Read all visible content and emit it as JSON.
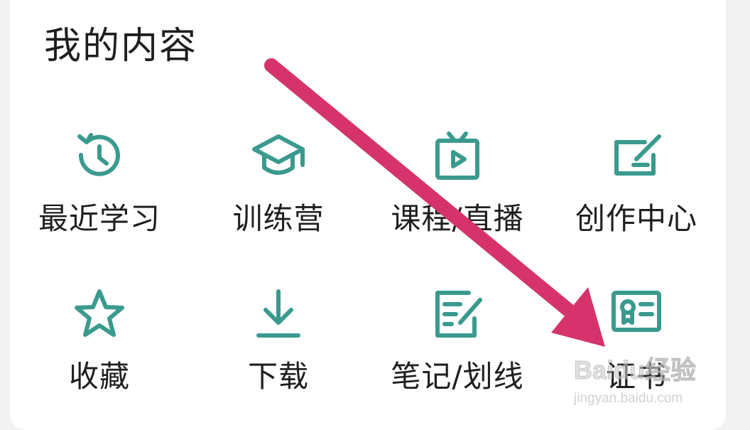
{
  "section": {
    "title": "我的内容"
  },
  "accent_color": "#3a9a8e",
  "items": [
    {
      "label": "最近学习",
      "icon": "history-clock-icon"
    },
    {
      "label": "训练营",
      "icon": "graduation-cap-icon"
    },
    {
      "label": "课程/直播",
      "icon": "tv-play-icon"
    },
    {
      "label": "创作中心",
      "icon": "edit-pen-icon"
    },
    {
      "label": "收藏",
      "icon": "star-icon"
    },
    {
      "label": "下载",
      "icon": "download-icon"
    },
    {
      "label": "笔记/划线",
      "icon": "note-edit-icon"
    },
    {
      "label": "证书",
      "icon": "certificate-icon"
    }
  ],
  "annotation": {
    "color": "#d6336c"
  },
  "watermark": {
    "logo": "Baidu经验",
    "url": "jingyan.baidu.com"
  }
}
